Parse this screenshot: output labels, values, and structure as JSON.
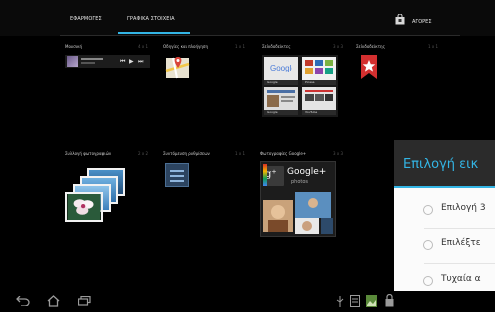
{
  "tabs": {
    "apps": "ΕΦΑΡΜΟΓΕΣ",
    "widgets": "ΓΡΑΦΙΚΑ ΣΤΟΙΧΕΙΑ"
  },
  "store": {
    "label": "ΑΓΟΡΕΣ"
  },
  "widgets": [
    {
      "title": "Μουσική",
      "size": "4 x 1"
    },
    {
      "title": "Οδηγίες και πλοήγηση",
      "size": "1 x 1"
    },
    {
      "title": "Σελιδοδείκτες",
      "size": "3 x 3"
    },
    {
      "title": "Σελιδοδείκτης",
      "size": "1 x 1"
    },
    {
      "title": "Συλλογή φωτογραφιών",
      "size": "2 x 2"
    },
    {
      "title": "Συντόμευση ρυθμίσεων",
      "size": "1 x 1"
    },
    {
      "title": "Φωτογραφίες Google+",
      "size": "3 x 3"
    }
  ],
  "bookmark_thumbs": [
    "Google",
    "Picasa",
    "Google",
    "YouTube"
  ],
  "gplus_widget": {
    "name": "Google+",
    "sub": "photos"
  },
  "dialog": {
    "title": "Επιλογή εικ",
    "options": [
      "Επιλογή 3",
      "Επιλέξτε",
      "Τυχαία α"
    ]
  },
  "icons": {
    "store": "shopping-bag-icon",
    "back": "back-icon",
    "home": "home-icon",
    "recents": "recent-apps-icon",
    "usb": "usb-icon",
    "notification": "notification-icon",
    "gallery": "gallery-status-icon",
    "lock": "lock-icon"
  },
  "colors": {
    "accent": "#33b5e5",
    "background": "#000000"
  }
}
